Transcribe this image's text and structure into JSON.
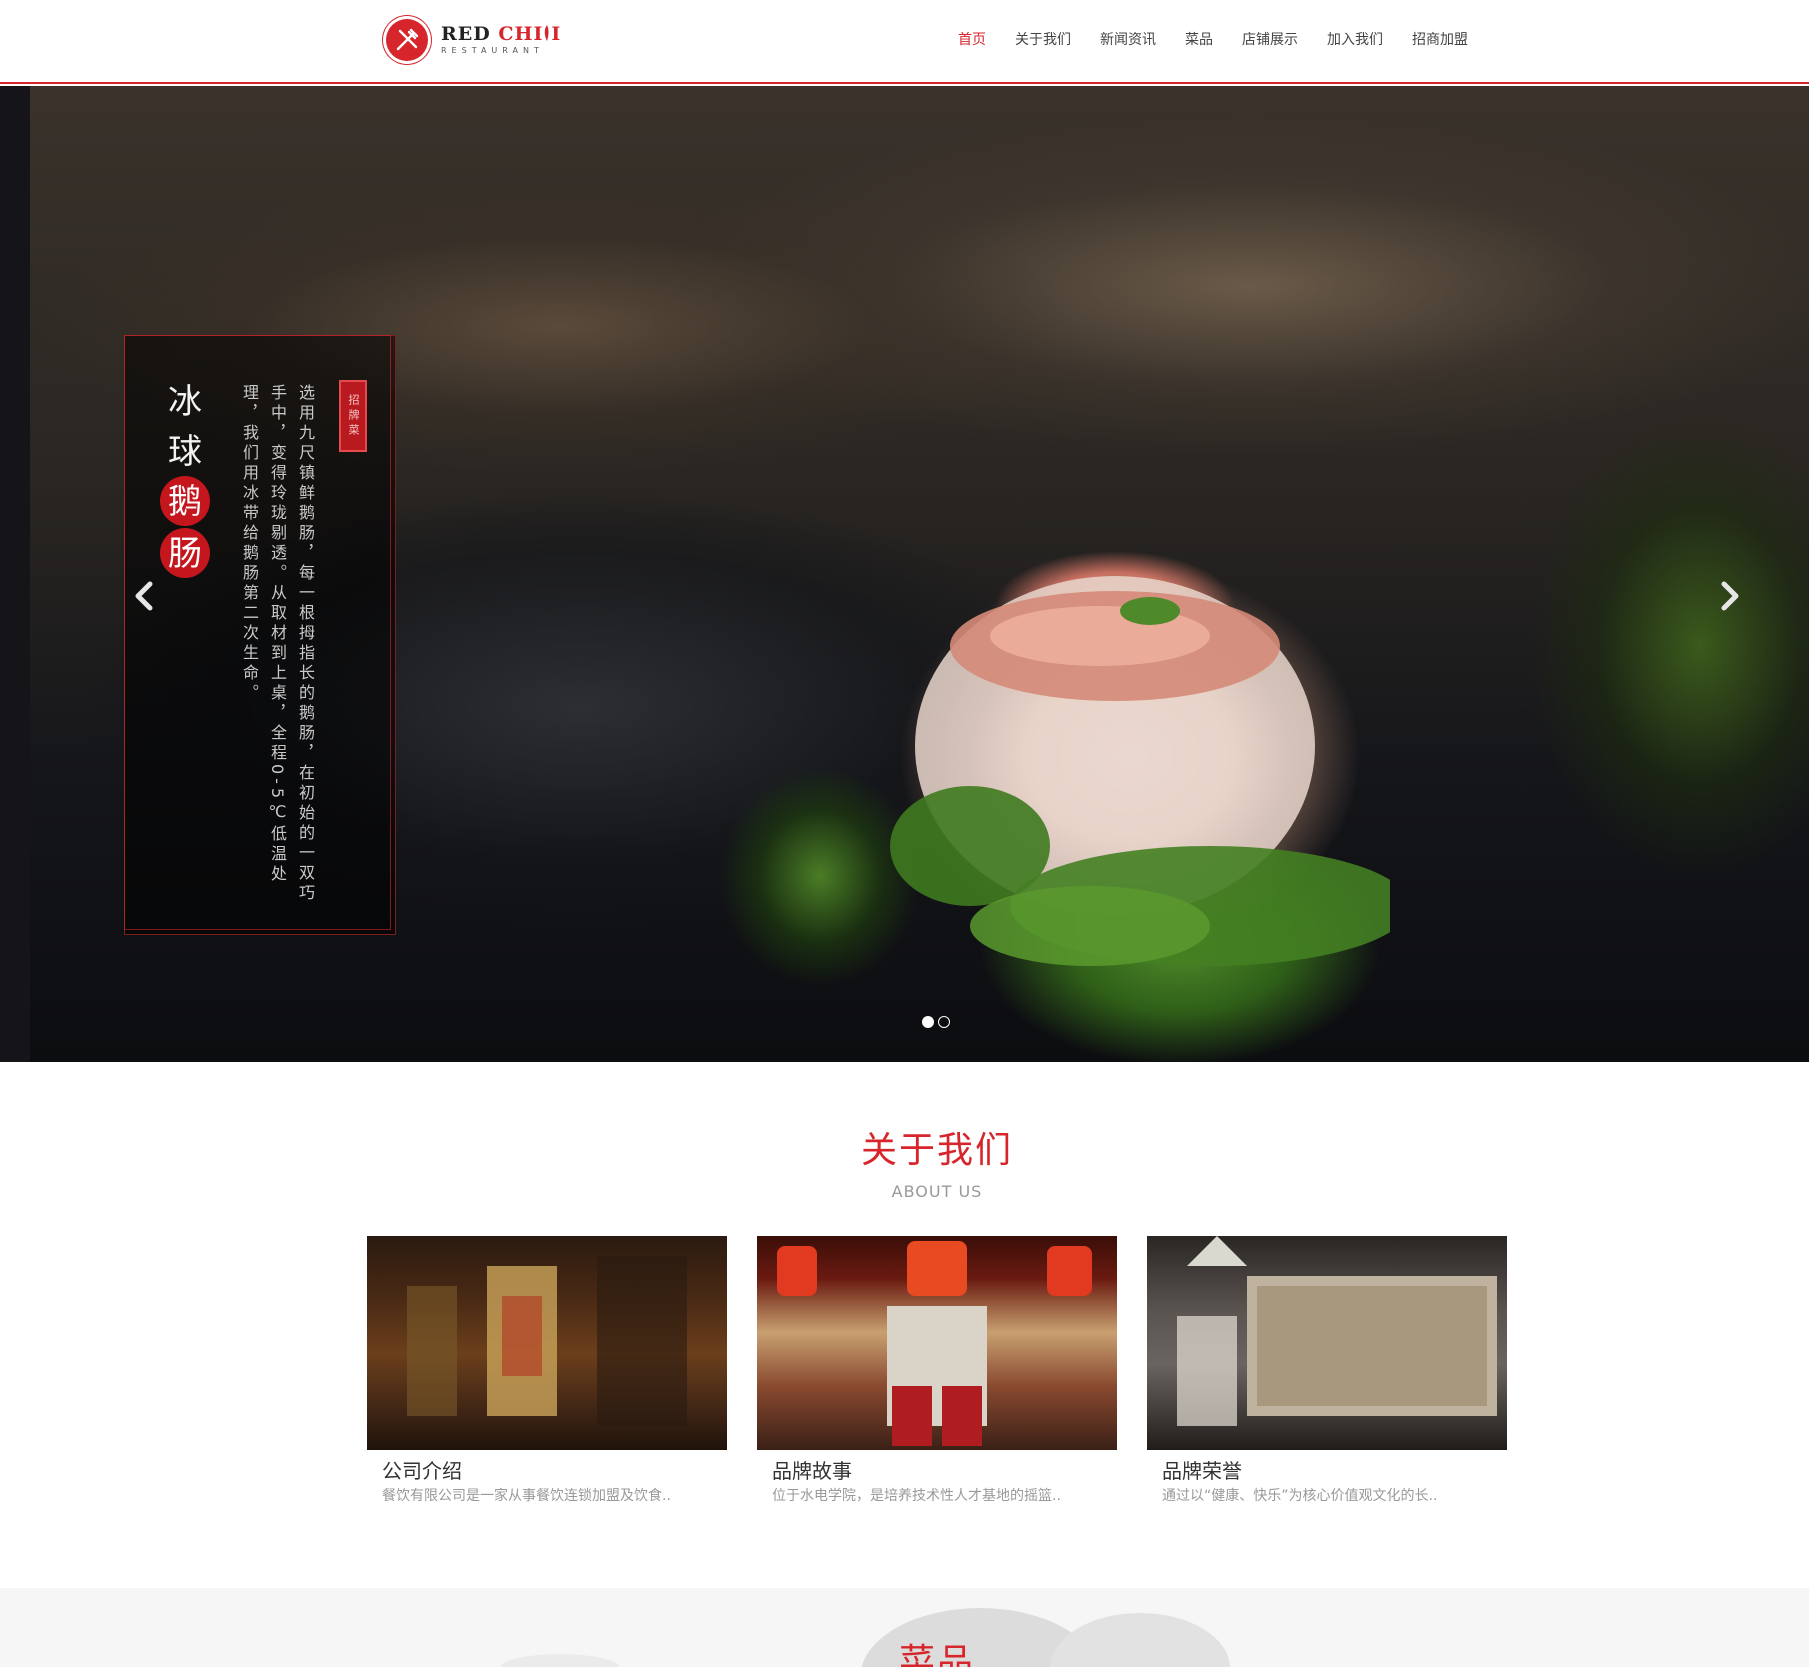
{
  "brand": {
    "name_part1": "RED",
    "name_part2": "CHI",
    "name_part3": "I",
    "sub": "RESTAURANT",
    "accent": "#d6262c"
  },
  "nav": {
    "items": [
      {
        "label": "首页",
        "active": true
      },
      {
        "label": "关于我们",
        "active": false
      },
      {
        "label": "新闻资讯",
        "active": false
      },
      {
        "label": "菜品",
        "active": false
      },
      {
        "label": "店铺展示",
        "active": false
      },
      {
        "label": "加入我们",
        "active": false
      },
      {
        "label": "招商加盟",
        "active": false
      }
    ]
  },
  "hero": {
    "caption_title": [
      "冰",
      "球",
      "鹅",
      "肠"
    ],
    "seal_text": "招牌菜",
    "caption_body": "选用九尺镇鲜鹅肠，每一根拇指长的鹅肠，在初始的一双巧手中，变得玲珑剔透。从取材到上桌，全程0-5℃低温处理，我们用冰带给鹅肠第二次生命。",
    "prev_icon": "chevron-left-icon",
    "next_icon": "chevron-right-icon",
    "slides_total": 2,
    "slide_active": 1
  },
  "about": {
    "title": "关于我们",
    "subtitle": "ABOUT US",
    "cards": [
      {
        "title": "公司介绍",
        "desc": "餐饮有限公司是一家从事餐饮连锁加盟及饮食.."
      },
      {
        "title": "品牌故事",
        "desc": "位于水电学院，是培养技术性人才基地的摇篮.."
      },
      {
        "title": "品牌荣誉",
        "desc": "通过以“健康、快乐”为核心价值观文化的长.."
      }
    ]
  },
  "menu_section": {
    "title": "菜品"
  }
}
